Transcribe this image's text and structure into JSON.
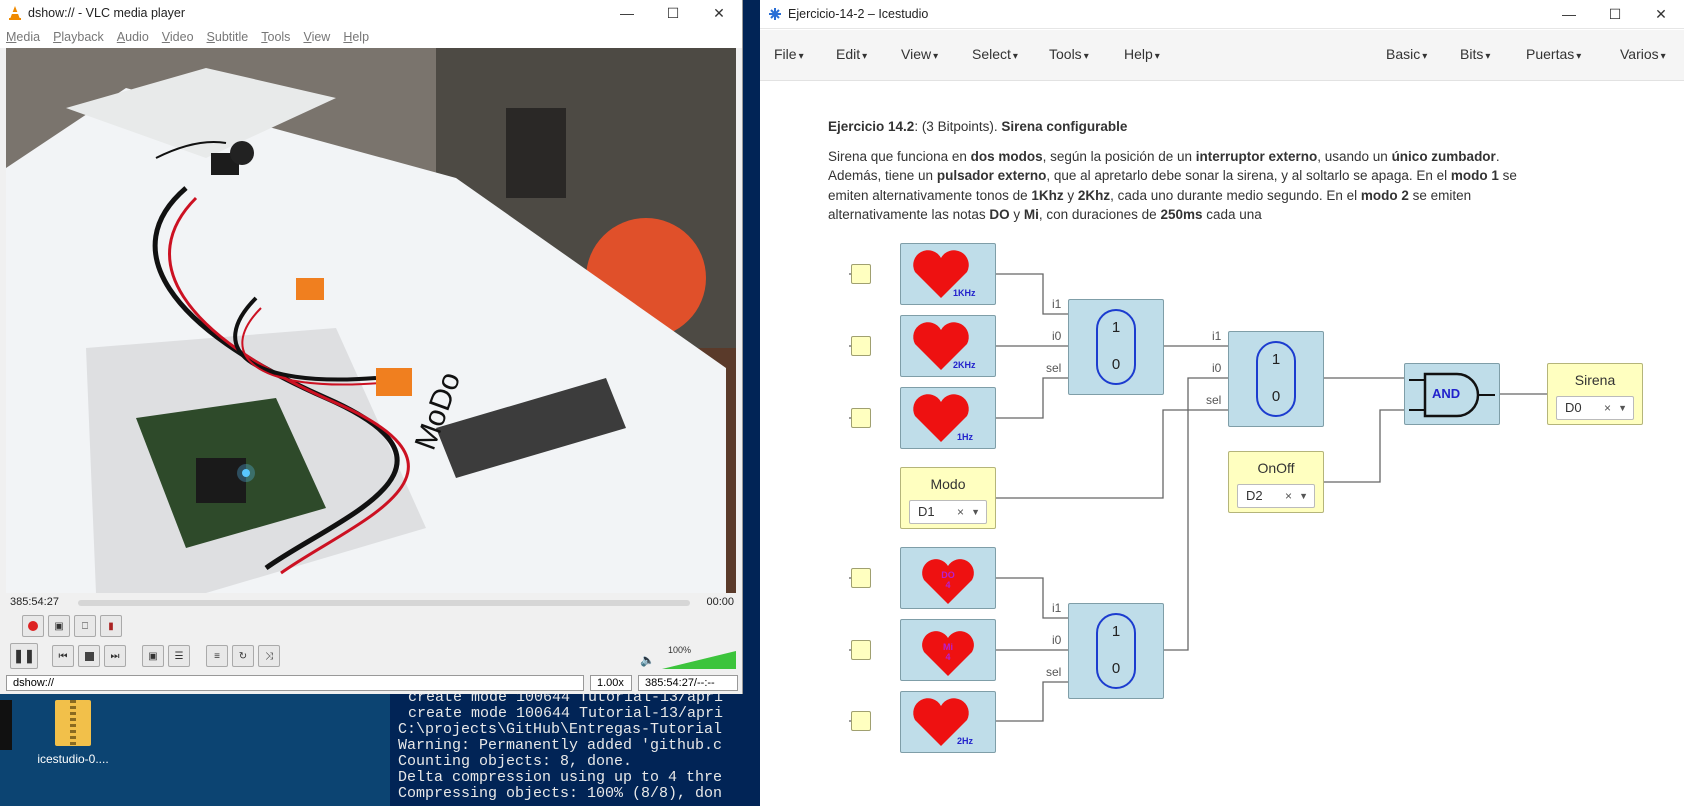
{
  "vlc": {
    "title": "dshow:// - VLC media player",
    "menu": [
      "Media",
      "Playback",
      "Audio",
      "Video",
      "Subtitle",
      "Tools",
      "View",
      "Help"
    ],
    "time_elapsed": "385:54:27",
    "time_total": "00:00",
    "media_url": "dshow://",
    "speed": "1.00x",
    "time_status": "385:54:27/--:--",
    "volume_label": "100%",
    "volume_level": 1.0
  },
  "desktop": {
    "icon_label": "icestudio-0....",
    "terminal_lines": [
      "create mode 100644 Tutorial-13/apri",
      "create mode 100644 Tutorial-13/apri",
      "C:\\projects\\GitHub\\Entregas-Tutorial",
      "Warning: Permanently added 'github.c",
      "Counting objects: 8, done.",
      "Delta compression using up to 4 thre",
      "Compressing objects: 100% (8/8), don"
    ]
  },
  "icestudio": {
    "title": "Ejercicio-14-2 – Icestudio",
    "menu_left": [
      "File",
      "Edit",
      "View",
      "Select",
      "Tools",
      "Help"
    ],
    "menu_right": [
      "Basic",
      "Bits",
      "Puertas",
      "Varios"
    ],
    "description": {
      "title_bold": "Ejercicio 14.2",
      "title_mid": ": (3 Bitpoints). ",
      "title_tail": "Sirena configurable",
      "para": [
        {
          "t": "Sirena que funciona en ",
          "b": false
        },
        {
          "t": "dos modos",
          "b": true
        },
        {
          "t": ", según la posición de un ",
          "b": false
        },
        {
          "t": "interruptor externo",
          "b": true
        },
        {
          "t": ", usando un ",
          "b": false
        },
        {
          "t": "único zumbador",
          "b": true
        },
        {
          "t": ". Además, tiene un ",
          "b": false
        },
        {
          "t": "pulsador externo",
          "b": true
        },
        {
          "t": ", que al apretarlo debe sonar la sirena, y al soltarlo se apaga. En el ",
          "b": false
        },
        {
          "t": "modo 1",
          "b": true
        },
        {
          "t": " se emiten alternativamente tonos de ",
          "b": false
        },
        {
          "t": "1Khz",
          "b": true
        },
        {
          "t": " y ",
          "b": false
        },
        {
          "t": "2Khz",
          "b": true
        },
        {
          "t": ", cada uno durante medio segundo. En el ",
          "b": false
        },
        {
          "t": "modo 2",
          "b": true
        },
        {
          "t": " se emiten alternativamente las notas ",
          "b": false
        },
        {
          "t": "DO",
          "b": true
        },
        {
          "t": " y ",
          "b": false
        },
        {
          "t": "Mi",
          "b": true
        },
        {
          "t": ", con duraciones de ",
          "b": false
        },
        {
          "t": "250ms",
          "b": true
        },
        {
          "t": " cada una",
          "b": false
        }
      ]
    },
    "hearts": [
      "1KHz",
      "2KHz",
      "1Hz",
      "DO 4",
      "Mi 4",
      "2Hz"
    ],
    "mux_ports": {
      "i1": "i1",
      "i0": "i0",
      "sel": "sel"
    },
    "mux_values": {
      "top": "1",
      "bottom": "0"
    },
    "modo": {
      "label": "Modo",
      "pin": "D1"
    },
    "onoff": {
      "label": "OnOff",
      "pin": "D2"
    },
    "sirena": {
      "label": "Sirena",
      "pin": "D0"
    },
    "and_label": "AND",
    "clear_glyph": "×",
    "caret_glyph": "▼"
  },
  "colors": {
    "heart": "#ee1111",
    "block": "#bfdde9",
    "io_block": "#ffffc0",
    "mux_outline": "#1c3ccf"
  }
}
